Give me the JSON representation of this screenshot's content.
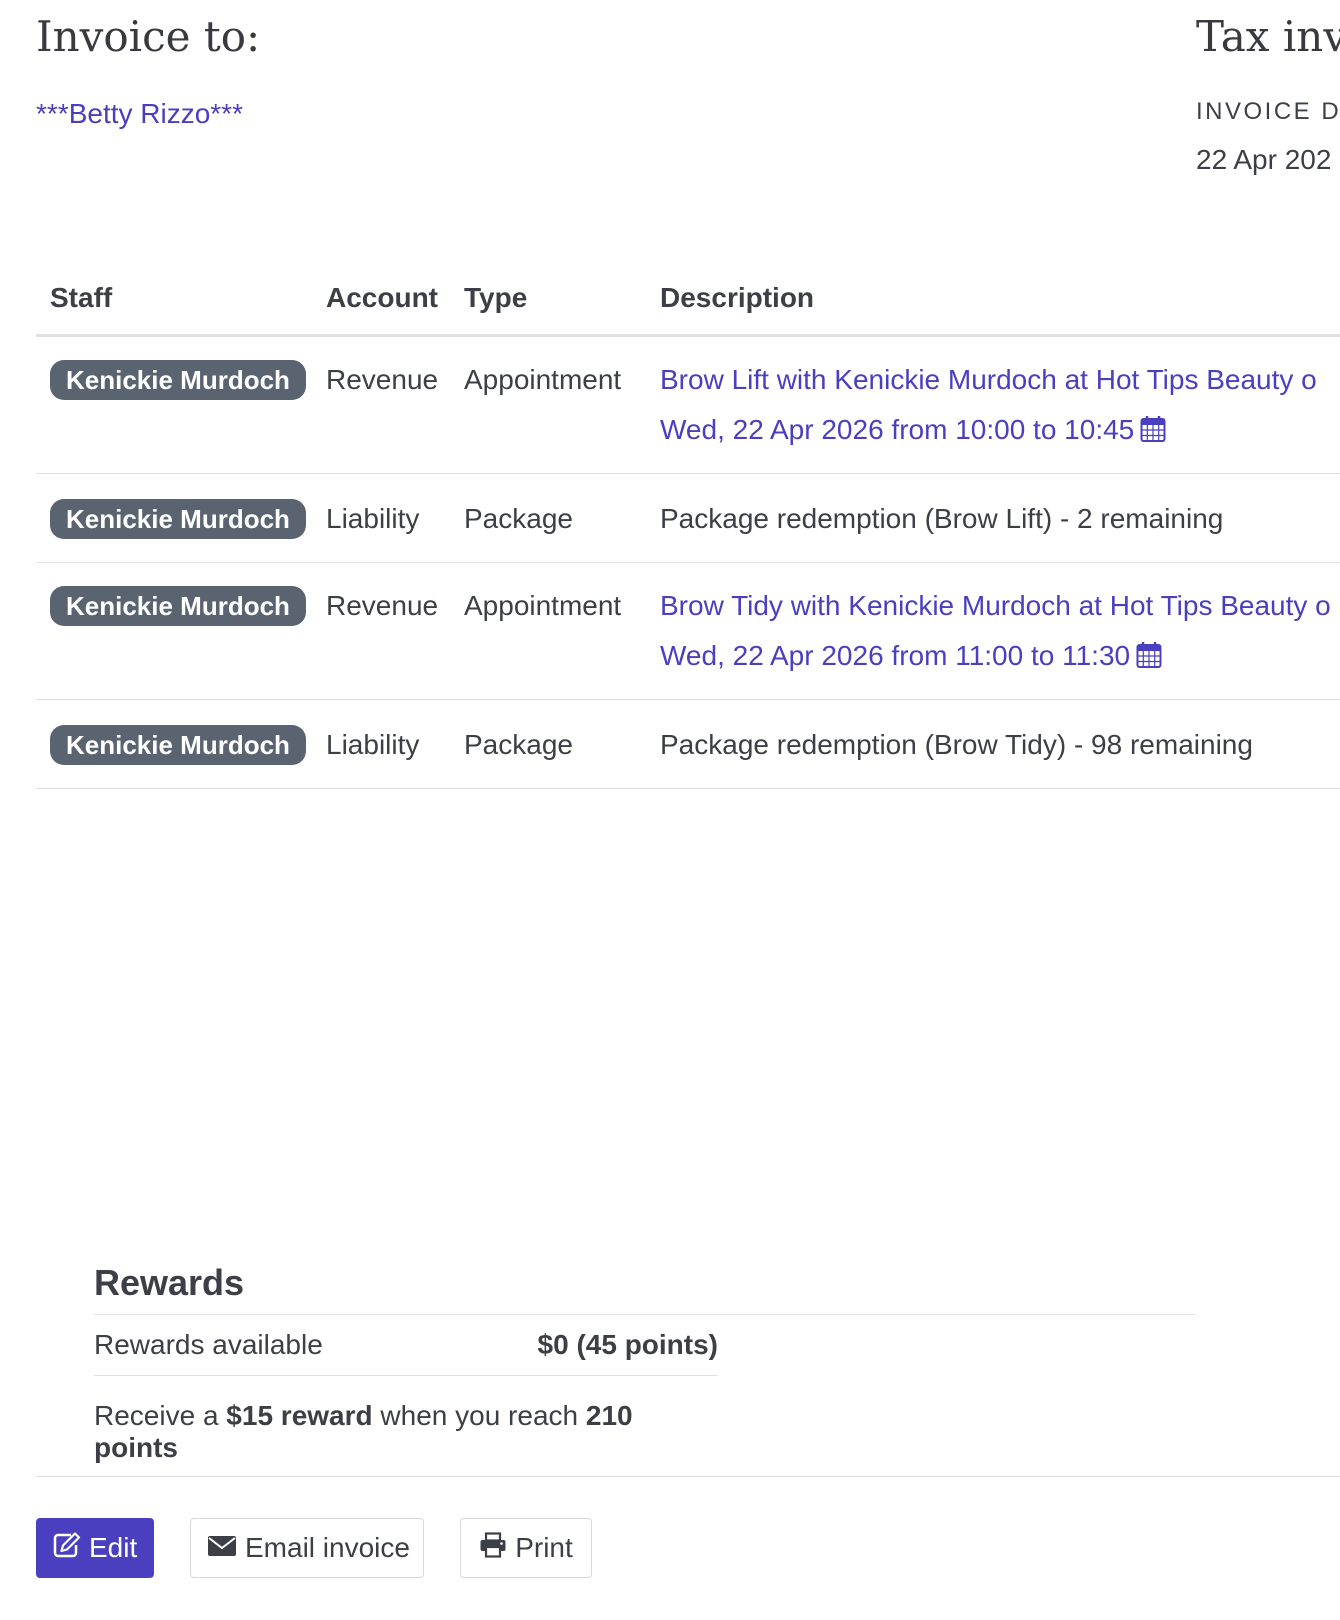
{
  "header": {
    "invoice_to": "Invoice to:",
    "client_name": "***Betty Rizzo***",
    "tax_invoice": "Tax inv",
    "invoice_date_label": "INVOICE D",
    "invoice_date_value": "22 Apr 202"
  },
  "table": {
    "columns": {
      "staff": "Staff",
      "account": "Account",
      "type": "Type",
      "description": "Description"
    },
    "rows": [
      {
        "staff": "Kenickie Murdoch",
        "account": "Revenue",
        "type": "Appointment",
        "desc_line1": "Brow Lift with Kenickie Murdoch at Hot Tips Beauty o",
        "desc_line2": "Wed, 22 Apr 2026 from 10:00 to 10:45"
      },
      {
        "staff": "Kenickie Murdoch",
        "account": "Liability",
        "type": "Package",
        "desc": "Package redemption (Brow Lift) - 2 remaining"
      },
      {
        "staff": "Kenickie Murdoch",
        "account": "Revenue",
        "type": "Appointment",
        "desc_line1": "Brow Tidy with Kenickie Murdoch at Hot Tips Beauty o",
        "desc_line2": "Wed, 22 Apr 2026 from 11:00 to 11:30"
      },
      {
        "staff": "Kenickie Murdoch",
        "account": "Liability",
        "type": "Package",
        "desc": "Package redemption (Brow Tidy) - 98 remaining"
      }
    ]
  },
  "rewards": {
    "title": "Rewards",
    "available_label": "Rewards available",
    "available_value": "$0 (45 points)",
    "note_prefix": "Receive a",
    "note_reward": "$15 reward",
    "note_middle": "when you reach",
    "note_points": "210 points"
  },
  "actions": {
    "edit": "Edit",
    "email": "Email invoice",
    "print": "Print"
  },
  "colors": {
    "link": "#4a3fbf",
    "badge": "#5a6470",
    "primary_button": "#4a3fbf"
  }
}
